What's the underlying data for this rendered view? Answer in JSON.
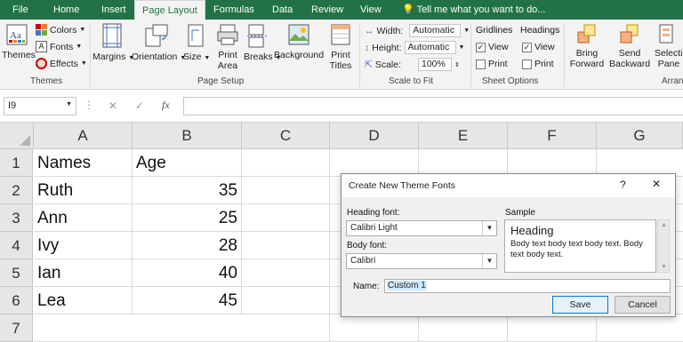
{
  "tabs": {
    "file": "File",
    "home": "Home",
    "insert": "Insert",
    "page_layout": "Page Layout",
    "formulas": "Formulas",
    "data": "Data",
    "review": "Review",
    "view": "View",
    "tell": "Tell me what you want to do..."
  },
  "ribbon": {
    "themes": {
      "themes": "Themes",
      "colors": "Colors",
      "fonts": "Fonts",
      "effects": "Effects",
      "group": "Themes"
    },
    "page_setup": {
      "margins": "Margins",
      "orientation": "Orientation",
      "size": "Size",
      "print_area": "Print\nArea",
      "breaks": "Breaks",
      "background": "Background",
      "print_titles": "Print\nTitles",
      "group": "Page Setup"
    },
    "scale": {
      "width_label": "Width:",
      "width_value": "Automatic",
      "height_label": "Height:",
      "height_value": "Automatic",
      "scale_label": "Scale:",
      "scale_value": "100%",
      "group": "Scale to Fit"
    },
    "sheet_options": {
      "gridlines": "Gridlines",
      "headings": "Headings",
      "view1": "View",
      "print1": "Print",
      "view2": "View",
      "print2": "Print",
      "group": "Sheet Options"
    },
    "arrange": {
      "bring_forward": "Bring\nForward",
      "send_backward": "Send\nBackward",
      "selection": "Selectio\nPane",
      "group": "Arran"
    }
  },
  "formula_bar": {
    "name_box": "I9",
    "fx": "fx",
    "value": ""
  },
  "sheet": {
    "columns": [
      "A",
      "B",
      "C",
      "D",
      "E",
      "F",
      "G"
    ],
    "rows": [
      "1",
      "2",
      "3",
      "4",
      "5",
      "6",
      "7"
    ],
    "data": [
      [
        "Names",
        "Age"
      ],
      [
        "Ruth",
        "35"
      ],
      [
        "Ann",
        "25"
      ],
      [
        "Ivy",
        "28"
      ],
      [
        "Ian",
        "40"
      ],
      [
        "Lea",
        "45"
      ]
    ]
  },
  "dialog": {
    "title": "Create New Theme Fonts",
    "help": "?",
    "close": "✕",
    "heading_font_label": "Heading font:",
    "heading_font_value": "Calibri Light",
    "body_font_label": "Body font:",
    "body_font_value": "Calibri",
    "sample_label": "Sample",
    "sample_heading": "Heading",
    "sample_body": "Body text body text body text. Body text body text.",
    "name_label": "Name:",
    "name_value": "Custom 1",
    "save": "Save",
    "cancel": "Cancel"
  },
  "colors": {
    "excel_green": "#217346",
    "ribbon_bg": "#f3f3f3",
    "header_bg": "#e6e6e6",
    "selection": "#cce8ff"
  }
}
